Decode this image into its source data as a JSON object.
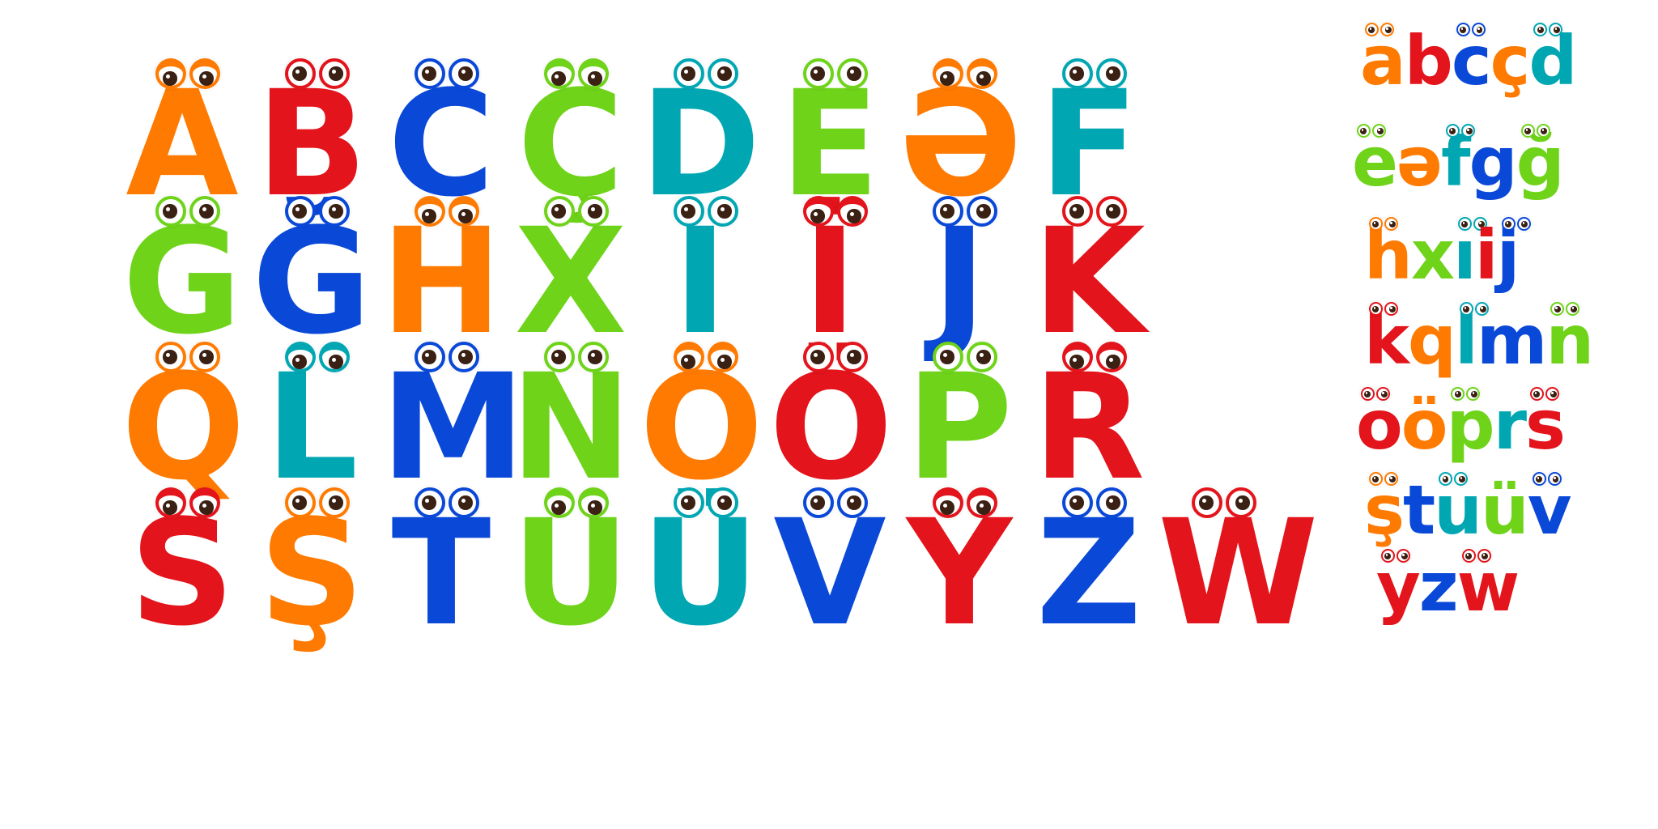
{
  "colors": {
    "orange": "#ff7a00",
    "red": "#e3141b",
    "blue": "#0a48d8",
    "green": "#6fd31a",
    "teal": "#00a7b3",
    "pupil": "#3a2114"
  },
  "uppercase_rows": [
    [
      {
        "char": "A",
        "color": "orange"
      },
      {
        "char": "B",
        "color": "red"
      },
      {
        "char": "C",
        "color": "blue"
      },
      {
        "char": "Ç",
        "color": "green"
      },
      {
        "char": "D",
        "color": "teal"
      },
      {
        "char": "E",
        "color": "green"
      },
      {
        "char": "Ə",
        "color": "orange"
      },
      {
        "char": "F",
        "color": "teal"
      }
    ],
    [
      {
        "char": "G",
        "color": "green"
      },
      {
        "char": "Ğ",
        "color": "blue"
      },
      {
        "char": "H",
        "color": "orange"
      },
      {
        "char": "X",
        "color": "green"
      },
      {
        "char": "I",
        "color": "teal"
      },
      {
        "char": "İ",
        "color": "red"
      },
      {
        "char": "J",
        "color": "blue"
      },
      {
        "char": "K",
        "color": "red"
      }
    ],
    [
      {
        "char": "Q",
        "color": "orange"
      },
      {
        "char": "L",
        "color": "teal"
      },
      {
        "char": "M",
        "color": "blue"
      },
      {
        "char": "N",
        "color": "green"
      },
      {
        "char": "O",
        "color": "orange"
      },
      {
        "char": "Ö",
        "color": "red"
      },
      {
        "char": "P",
        "color": "green"
      },
      {
        "char": "R",
        "color": "red"
      }
    ],
    [
      {
        "char": "S",
        "color": "red"
      },
      {
        "char": "Ş",
        "color": "orange"
      },
      {
        "char": "T",
        "color": "blue"
      },
      {
        "char": "U",
        "color": "green"
      },
      {
        "char": "Ü",
        "color": "teal"
      },
      {
        "char": "V",
        "color": "blue"
      },
      {
        "char": "Y",
        "color": "red"
      },
      {
        "char": "Z",
        "color": "blue"
      },
      {
        "char": "W",
        "color": "red"
      }
    ]
  ],
  "lowercase_rows": [
    [
      {
        "char": "a",
        "color": "orange"
      },
      {
        "char": "b",
        "color": "red"
      },
      {
        "char": "c",
        "color": "blue"
      },
      {
        "char": "ç",
        "color": "orange"
      },
      {
        "char": "d",
        "color": "teal"
      }
    ],
    [
      {
        "char": "e",
        "color": "green"
      },
      {
        "char": "ə",
        "color": "orange"
      },
      {
        "char": "f",
        "color": "teal"
      },
      {
        "char": "g",
        "color": "blue"
      },
      {
        "char": "ğ",
        "color": "green"
      }
    ],
    [
      {
        "char": "h",
        "color": "orange"
      },
      {
        "char": "x",
        "color": "green"
      },
      {
        "char": "ı",
        "color": "teal"
      },
      {
        "char": "i",
        "color": "red"
      },
      {
        "char": "j",
        "color": "blue"
      }
    ],
    [
      {
        "char": "k",
        "color": "red"
      },
      {
        "char": "q",
        "color": "orange"
      },
      {
        "char": "l",
        "color": "teal"
      },
      {
        "char": "m",
        "color": "blue"
      },
      {
        "char": "n",
        "color": "green"
      }
    ],
    [
      {
        "char": "o",
        "color": "red"
      },
      {
        "char": "ö",
        "color": "orange"
      },
      {
        "char": "p",
        "color": "green"
      },
      {
        "char": "r",
        "color": "teal"
      },
      {
        "char": "s",
        "color": "red"
      }
    ],
    [
      {
        "char": "ş",
        "color": "orange"
      },
      {
        "char": "t",
        "color": "blue"
      },
      {
        "char": "u",
        "color": "teal"
      },
      {
        "char": "ü",
        "color": "green"
      },
      {
        "char": "v",
        "color": "blue"
      }
    ],
    [
      {
        "char": "y",
        "color": "red"
      },
      {
        "char": "z",
        "color": "blue"
      },
      {
        "char": "w",
        "color": "red"
      }
    ]
  ]
}
